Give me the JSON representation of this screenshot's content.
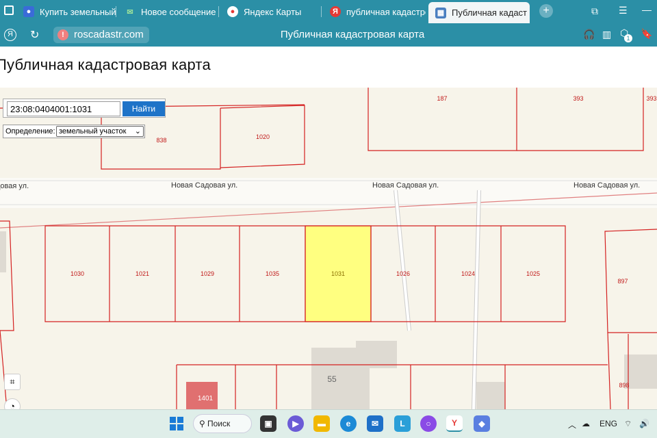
{
  "browser": {
    "tabs": [
      {
        "label": "Купить земельный у",
        "fav_color": "#3a6bd8",
        "fav_glyph": "●"
      },
      {
        "label": "Новое сообщение",
        "fav_color": "#2e8b57",
        "fav_glyph": "✉"
      },
      {
        "label": "Яндекс Карты",
        "fav_color": "#e53935",
        "fav_glyph": "●"
      },
      {
        "label": "публичная кадастро",
        "fav_color": "#e53935",
        "fav_glyph": "Я"
      },
      {
        "label": "Публичная кадаст",
        "fav_color": "#4a7fc0",
        "fav_glyph": "▦",
        "active": true
      }
    ],
    "url": "roscadastr.com",
    "page_title": "Публичная кадастровая карта",
    "badge_count": "1"
  },
  "page": {
    "heading": "Публичная кадастровая карта",
    "search": {
      "value": "23:08:0404001:1031",
      "button": "Найти"
    },
    "definition": {
      "label": "Определение:",
      "selected": "земельный участок"
    }
  },
  "map": {
    "streets": [
      "довая ул.",
      "Новая Садовая ул.",
      "Новая Садовая ул.",
      "Новая Садовая ул."
    ],
    "parcels_top": [
      "838",
      "1020",
      "187",
      "393",
      "393"
    ],
    "parcels_row": [
      "1030",
      "1021",
      "1029",
      "1035",
      "1031",
      "1026",
      "1024",
      "1025"
    ],
    "parcels_right": [
      "897",
      "898"
    ],
    "building_number": "55",
    "small_parcel": "1401",
    "highlight_color": "#ffff80",
    "boundary_color": "#d42020"
  },
  "taskbar": {
    "search_label": "Поиск",
    "lang": "ENG"
  }
}
